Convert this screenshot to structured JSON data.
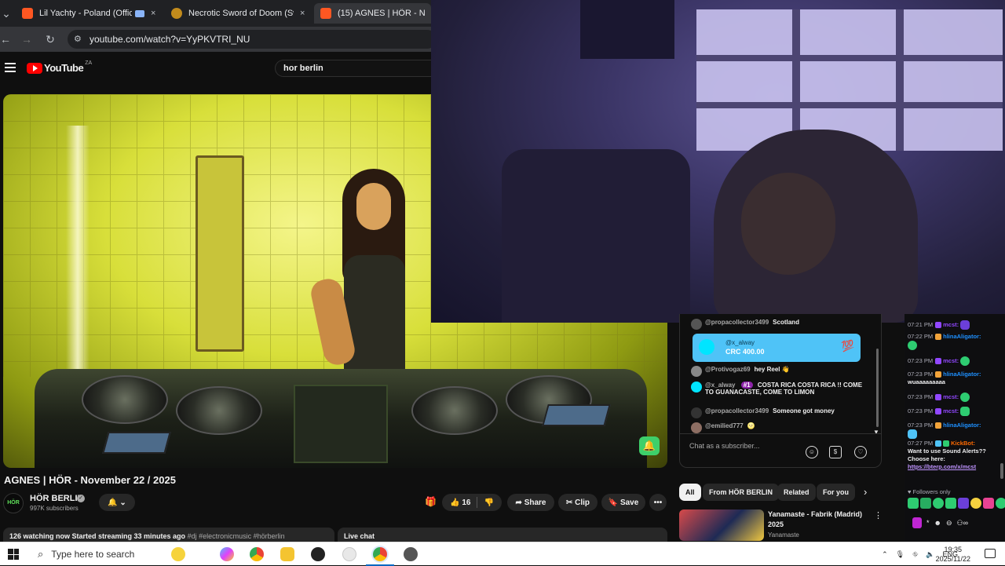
{
  "browser": {
    "tabs": [
      {
        "title": "Lil Yachty - Poland (Official",
        "close": "×"
      },
      {
        "title": "Necrotic Sword of Doom (Swor",
        "close": "×"
      },
      {
        "title": "(15) AGNES | HÖR - Novem",
        "close": "×"
      }
    ],
    "url": "youtube.com/watch?v=YyPKVTRI_NU"
  },
  "youtube": {
    "logo_text": "YouTube",
    "region": "ZA",
    "search_value": "hor berlin",
    "video_title": "AGNES | HÖR - November 22 / 2025",
    "channel_name": "HÖR BERLIN",
    "channel_avatar_text": "HÖR",
    "subscribers": "997K subscribers",
    "likes": "16",
    "share_label": "Share",
    "clip_label": "Clip",
    "save_label": "Save",
    "description": "126 watching now  Started streaming 33 minutes ago",
    "description_tags": "#dj #electronicmusic #hörberlin",
    "live_chat_label": "Live chat"
  },
  "yt_chat": {
    "messages": [
      {
        "user": "@propacollector3499",
        "text": "Scotland"
      },
      {
        "user": "@Protivogaz69",
        "text": "hey Reel 👋"
      },
      {
        "user": "@x_alway",
        "badge": "#1",
        "text": "COSTA RICA COSTA RICA !! COME TO GUANACASTE, COME TO LIMON"
      },
      {
        "user": "@propacollector3499",
        "text": "Someone got money"
      },
      {
        "user": "@emilied777",
        "text": "🌝"
      }
    ],
    "superchat": {
      "user": "@x_alway",
      "amount": "CRC 400.00",
      "sticker": "💯"
    },
    "input_placeholder": "Chat as a subscriber..."
  },
  "chips": [
    "All",
    "From HÖR BERLIN",
    "Related",
    "For you"
  ],
  "related": {
    "title": "Yanamaste - Fabrik (Madrid) 2025",
    "channel": "Yanamaste"
  },
  "twitch_chat": {
    "messages": [
      {
        "time": "07:21 PM",
        "user": "mcst:",
        "color": "#9147ff",
        "text": ""
      },
      {
        "time": "07:22 PM",
        "user": "hlinaAligator:",
        "color": "#1e90ff",
        "text": ""
      },
      {
        "time": "07:23 PM",
        "user": "mcst:",
        "color": "#9147ff",
        "text": ""
      },
      {
        "time": "07:23 PM",
        "user": "hlinaAligator:",
        "color": "#1e90ff",
        "text": "wuaaaaaaaaa"
      },
      {
        "time": "07:23 PM",
        "user": "mcst:",
        "color": "#9147ff",
        "text": ""
      },
      {
        "time": "07:23 PM",
        "user": "mcst:",
        "color": "#9147ff",
        "text": ""
      },
      {
        "time": "07:23 PM",
        "user": "hlinaAligator:",
        "color": "#1e90ff",
        "text": ""
      },
      {
        "time": "07:27 PM",
        "user": "KickBot:",
        "color": "#ff6a00",
        "text": "Want to use Sound Alerts?? Choose here:"
      },
      {
        "link": "https://bterp.com/x/mcst"
      }
    ],
    "followers_only": "Followers only"
  },
  "taskbar": {
    "search_placeholder": "Type here to search",
    "language": "ENG",
    "time": "19:35",
    "date": "2025/11/22"
  }
}
